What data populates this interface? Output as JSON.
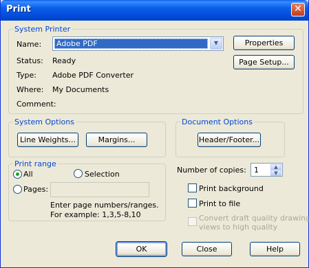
{
  "window": {
    "title": "Print",
    "close_glyph": "✕"
  },
  "system_printer": {
    "legend": "System Printer",
    "name_label": "Name:",
    "name_value": "Adobe PDF",
    "status_label": "Status:",
    "status_value": "Ready",
    "type_label": "Type:",
    "type_value": "Adobe PDF Converter",
    "where_label": "Where:",
    "where_value": "My Documents",
    "comment_label": "Comment:",
    "comment_value": "",
    "properties_button": "Properties",
    "page_setup_button": "Page Setup..."
  },
  "system_options": {
    "legend": "System Options",
    "line_weights_button": "Line Weights...",
    "margins_button": "Margins..."
  },
  "document_options": {
    "legend": "Document Options",
    "header_footer_button": "Header/Footer..."
  },
  "print_range": {
    "legend": "Print range",
    "all_label": "All",
    "selection_label": "Selection",
    "pages_label": "Pages:",
    "pages_value": "",
    "hint_line1": "Enter page numbers/ranges.",
    "hint_line2": "For example: 1,3,5-8,10",
    "selected": "all"
  },
  "copies": {
    "label": "Number of copies:",
    "value": "1"
  },
  "options": {
    "print_background": "Print background",
    "print_to_file": "Print to file",
    "convert_draft_line1": "Convert draft quality drawing",
    "convert_draft_line2": "views to high quality"
  },
  "buttons": {
    "ok": "OK",
    "close": "Close",
    "help": "Help"
  },
  "icons": {
    "dropdown": "chevron-down-icon",
    "spin_up": "spin-up-icon",
    "spin_down": "spin-down-icon"
  }
}
